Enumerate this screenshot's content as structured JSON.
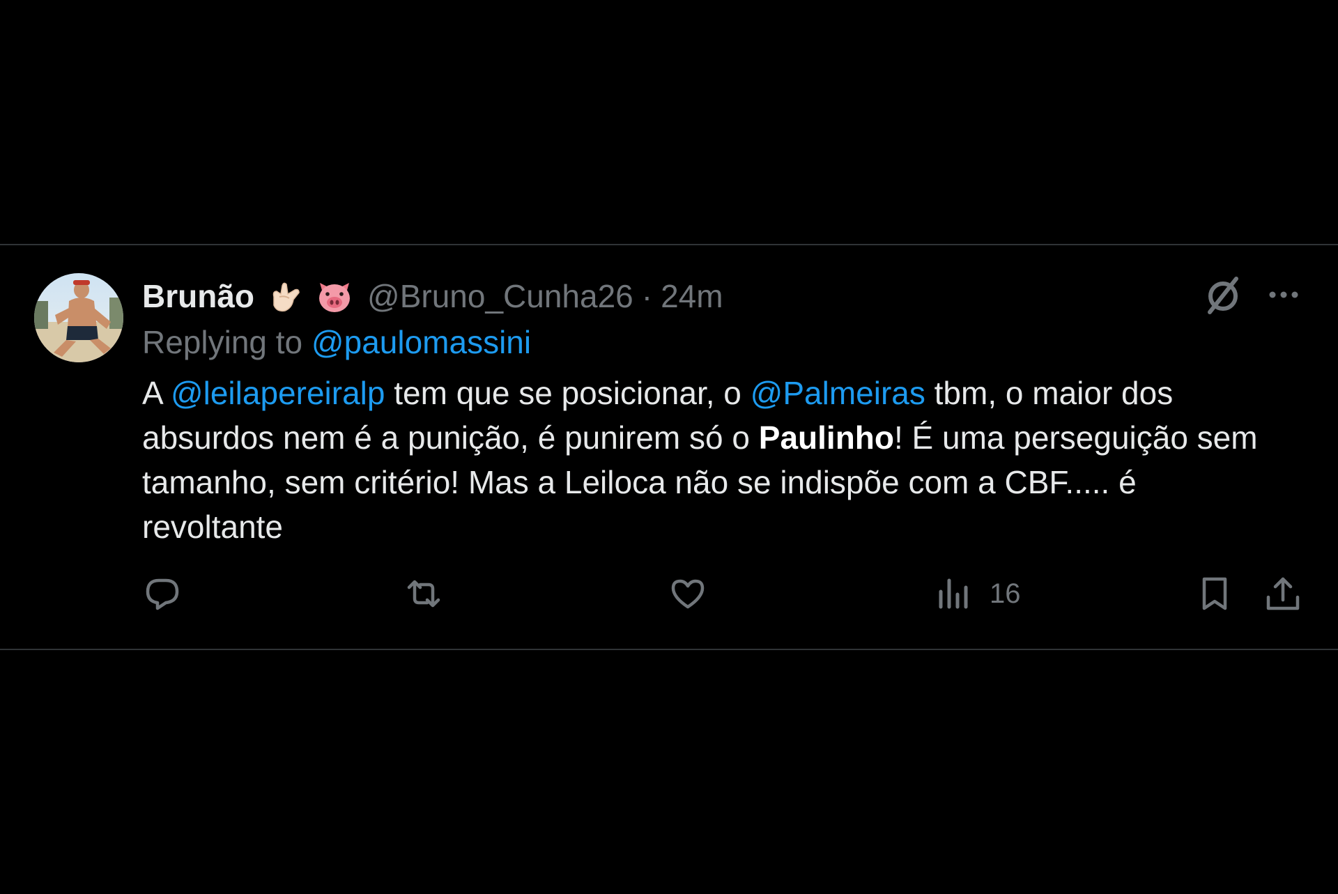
{
  "tweet": {
    "display_name": "Brunão",
    "emojis": [
      "call-me-hand-emoji",
      "pig-face-emoji"
    ],
    "handle": "@Bruno_Cunha26",
    "separator": "·",
    "time": "24m",
    "replying_prefix": "Replying to",
    "replying_to": "@paulomassini",
    "body": [
      {
        "type": "text",
        "value": "A "
      },
      {
        "type": "mention",
        "value": "@leilapereiralp"
      },
      {
        "type": "text",
        "value": " tem que se posicionar, o "
      },
      {
        "type": "mention",
        "value": "@Palmeiras"
      },
      {
        "type": "text",
        "value": " tbm, o maior dos absurdos nem é a punição, é punirem só o "
      },
      {
        "type": "bold",
        "value": "Paulinho"
      },
      {
        "type": "text",
        "value": "! É uma perseguição sem tamanho, sem critério! Mas a Leiloca não se indispõe com a CBF..... é revoltante"
      }
    ]
  },
  "actions": {
    "reply": {
      "icon": "reply-icon"
    },
    "retweet": {
      "icon": "retweet-icon"
    },
    "like": {
      "icon": "heart-icon"
    },
    "views": {
      "icon": "views-bar-chart-icon",
      "count": "16"
    },
    "bookmark": {
      "icon": "bookmark-icon"
    },
    "share": {
      "icon": "share-icon"
    }
  },
  "colors": {
    "background": "#000000",
    "text": "#e7e9ea",
    "muted": "#71767b",
    "link": "#1d9bf0",
    "border": "#2f3336"
  }
}
